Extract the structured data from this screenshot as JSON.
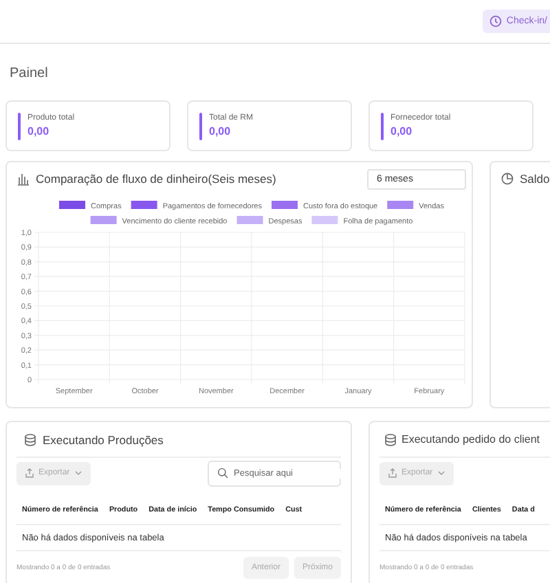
{
  "topbar": {
    "checkin_button": "Check-in/"
  },
  "page_title": "Painel",
  "stat_cards": [
    {
      "label": "Produto total",
      "value": "0,00"
    },
    {
      "label": "Total de RM",
      "value": "0,00"
    },
    {
      "label": "Fornecedor total",
      "value": "0,00"
    }
  ],
  "cash_flow": {
    "title": "Comparação de fluxo de dinheiro(Seis meses)",
    "period_select": "6 meses",
    "chart_data": {
      "type": "bar",
      "categories": [
        "September",
        "October",
        "November",
        "December",
        "January",
        "February"
      ],
      "ylim": [
        0,
        1
      ],
      "grid": true,
      "yticks": [
        {
          "value": 0,
          "label": "0"
        },
        {
          "value": 0.1,
          "label": "0,1"
        },
        {
          "value": 0.2,
          "label": "0,2"
        },
        {
          "value": 0.3,
          "label": "0,3"
        },
        {
          "value": 0.4,
          "label": "0,4"
        },
        {
          "value": 0.5,
          "label": "0,5"
        },
        {
          "value": 0.6,
          "label": "0,6"
        },
        {
          "value": 0.7,
          "label": "0,7"
        },
        {
          "value": 0.8,
          "label": "0,8"
        },
        {
          "value": 0.9,
          "label": "0,9"
        },
        {
          "value": 1,
          "label": "1,0"
        }
      ],
      "series": [
        {
          "name": "Compras",
          "color": "#7b4ce6",
          "values": [
            null,
            null,
            null,
            null,
            null,
            null
          ]
        },
        {
          "name": "Pagamentos de fornecedores",
          "color": "#8858ee",
          "values": [
            null,
            null,
            null,
            null,
            null,
            null
          ]
        },
        {
          "name": "Custo fora do estoque",
          "color": "#9a70f0",
          "values": [
            null,
            null,
            null,
            null,
            null,
            null
          ]
        },
        {
          "name": "Vendas",
          "color": "#a887f3",
          "values": [
            null,
            null,
            null,
            null,
            null,
            null
          ]
        },
        {
          "name": "Vencimento do cliente recebido",
          "color": "#b79cf5",
          "values": [
            null,
            null,
            null,
            null,
            null,
            null
          ]
        },
        {
          "name": "Despesas",
          "color": "#c5b1f7",
          "values": [
            null,
            null,
            null,
            null,
            null,
            null
          ]
        },
        {
          "name": "Folha de pagamento",
          "color": "#d6c8fa",
          "values": [
            null,
            null,
            null,
            null,
            null,
            null
          ]
        }
      ]
    }
  },
  "balance": {
    "title": "Saldo"
  },
  "tables": [
    {
      "title": "Executando Produções",
      "export_button": "Exportar",
      "search": {
        "placeholder": "Pesquisar aqui"
      },
      "columns": [
        "Número de referência",
        "Produto",
        "Data de início",
        "Tempo Consumido",
        "Cust"
      ],
      "empty_message": "Não há dados disponíveis na tabela",
      "info": "Mostrando 0 a 0 de 0 entradas",
      "pagination": [
        {
          "label": "Anterior",
          "disabled": true
        },
        {
          "label": "Próximo",
          "disabled": true
        }
      ]
    },
    {
      "title": "Executando pedido do client",
      "export_button": "Exportar",
      "columns": [
        "Número de referência",
        "Clientes",
        "Data d"
      ],
      "empty_message": "Não há dados disponíveis na tabela",
      "info": "Mostrando 0 a 0 de 0 entradas"
    }
  ]
}
